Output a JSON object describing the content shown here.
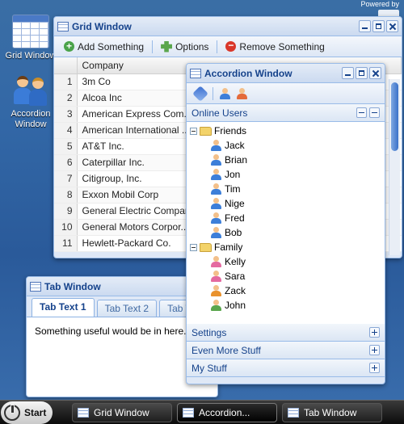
{
  "powered_by": "Powered by",
  "desktop": {
    "icons": [
      {
        "label": "Grid Window"
      },
      {
        "label": "Accordion Window"
      }
    ]
  },
  "grid_window": {
    "title": "Grid Window",
    "toolbar": {
      "add_label": "Add Something",
      "options_label": "Options",
      "remove_label": "Remove Something"
    },
    "column_header": "Company",
    "rows": [
      {
        "n": "1",
        "company": "3m Co"
      },
      {
        "n": "2",
        "company": "Alcoa Inc"
      },
      {
        "n": "3",
        "company": "American Express Com..."
      },
      {
        "n": "4",
        "company": "American International ..."
      },
      {
        "n": "5",
        "company": "AT&T Inc."
      },
      {
        "n": "6",
        "company": "Caterpillar Inc."
      },
      {
        "n": "7",
        "company": "Citigroup, Inc."
      },
      {
        "n": "8",
        "company": "Exxon Mobil Corp"
      },
      {
        "n": "9",
        "company": "General Electric Company"
      },
      {
        "n": "10",
        "company": "General Motors Corpor..."
      },
      {
        "n": "11",
        "company": "Hewlett-Packard Co."
      }
    ]
  },
  "tab_window": {
    "title": "Tab Window",
    "tabs": [
      "Tab Text 1",
      "Tab Text 2",
      "Tab T"
    ],
    "content": "Something useful would be in here."
  },
  "accordion_window": {
    "title": "Accordion Window",
    "online_users": {
      "title": "Online Users",
      "groups": [
        {
          "name": "Friends",
          "users": [
            {
              "name": "Jack",
              "color": "#3d7fd9"
            },
            {
              "name": "Brian",
              "color": "#3d7fd9"
            },
            {
              "name": "Jon",
              "color": "#3d7fd9"
            },
            {
              "name": "Tim",
              "color": "#3d7fd9"
            },
            {
              "name": "Nige",
              "color": "#3d7fd9"
            },
            {
              "name": "Fred",
              "color": "#3d7fd9"
            },
            {
              "name": "Bob",
              "color": "#3d7fd9"
            }
          ]
        },
        {
          "name": "Family",
          "users": [
            {
              "name": "Kelly",
              "color": "#e46aa0"
            },
            {
              "name": "Sara",
              "color": "#e46aa0"
            },
            {
              "name": "Zack",
              "color": "#e9922d"
            },
            {
              "name": "John",
              "color": "#5aa64d"
            }
          ]
        }
      ]
    },
    "sections": [
      "Settings",
      "Even More Stuff",
      "My Stuff"
    ]
  },
  "taskbar": {
    "start_label": "Start",
    "buttons": [
      "Grid Window",
      "Accordion...",
      "Tab Window"
    ]
  }
}
